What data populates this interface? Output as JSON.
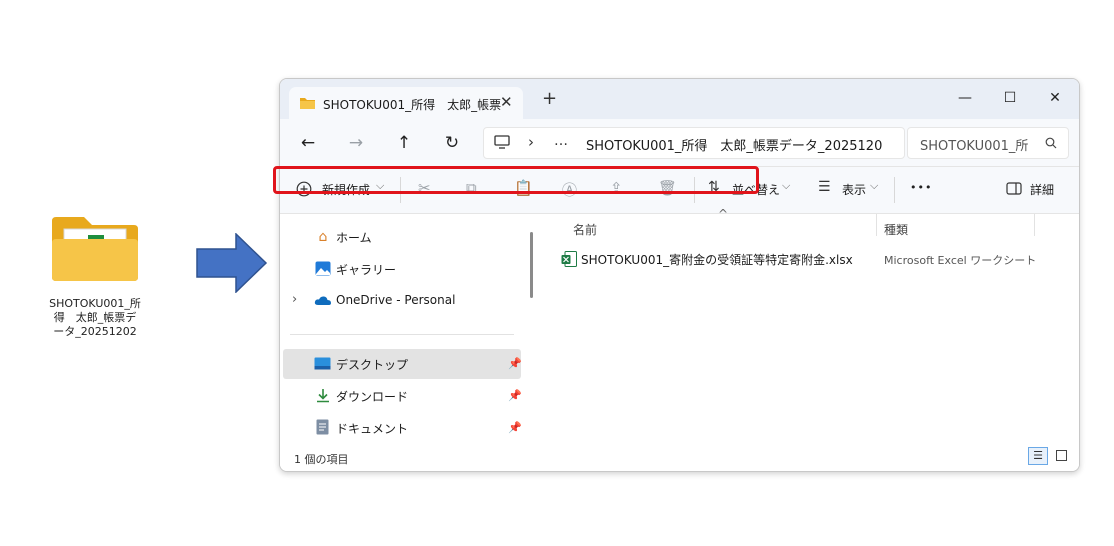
{
  "desktop_folder": {
    "label": "SHOTOKU001_所得　太郎_帳票データ_20251202",
    "label_display": "SHOTOKU001_所\n得　太郎_帳票デ\nータ_20251202",
    "icon": "folder-icon"
  },
  "arrow": {
    "icon": "arrow-right-icon",
    "color": "#4472c4"
  },
  "window": {
    "tab_title": "SHOTOKU001_所得　太郎_帳票",
    "tab_close": "✕",
    "new_tab": "+",
    "controls": {
      "minimize": "—",
      "maximize": "☐",
      "close": "✕"
    },
    "nav": {
      "back": "←",
      "forward": "→",
      "up": "↑",
      "refresh": "↻"
    },
    "address": {
      "more": "…",
      "chevron": "›",
      "path": "SHOTOKU001_所得　太郎_帳票データ_2025120"
    },
    "search": {
      "text": "SHOTOKU001_所"
    },
    "toolbar": {
      "new_label": "新規作成",
      "sort_label": "並べ替え",
      "view_label": "表示",
      "more": "•••",
      "details_label": "詳細",
      "chevron": "⌵"
    },
    "sidebar": {
      "items": [
        {
          "label": "ホーム",
          "icon": "home-icon"
        },
        {
          "label": "ギャラリー",
          "icon": "gallery-icon"
        },
        {
          "label": "OneDrive - Personal",
          "icon": "onedrive-icon"
        },
        {
          "label": "デスクトップ",
          "icon": "desktop-icon"
        },
        {
          "label": "ダウンロード",
          "icon": "download-icon"
        },
        {
          "label": "ドキュメント",
          "icon": "documents-icon"
        }
      ]
    },
    "content": {
      "columns": {
        "name": "名前",
        "type": "種類"
      },
      "files": [
        {
          "name": "SHOTOKU001_寄附金の受領証等特定寄附金.xlsx",
          "type": "Microsoft Excel ワークシート"
        }
      ]
    },
    "status": {
      "item_count": "1 個の項目"
    }
  },
  "colors": {
    "highlight_border": "#e0141b",
    "accent": "#0067c0"
  }
}
